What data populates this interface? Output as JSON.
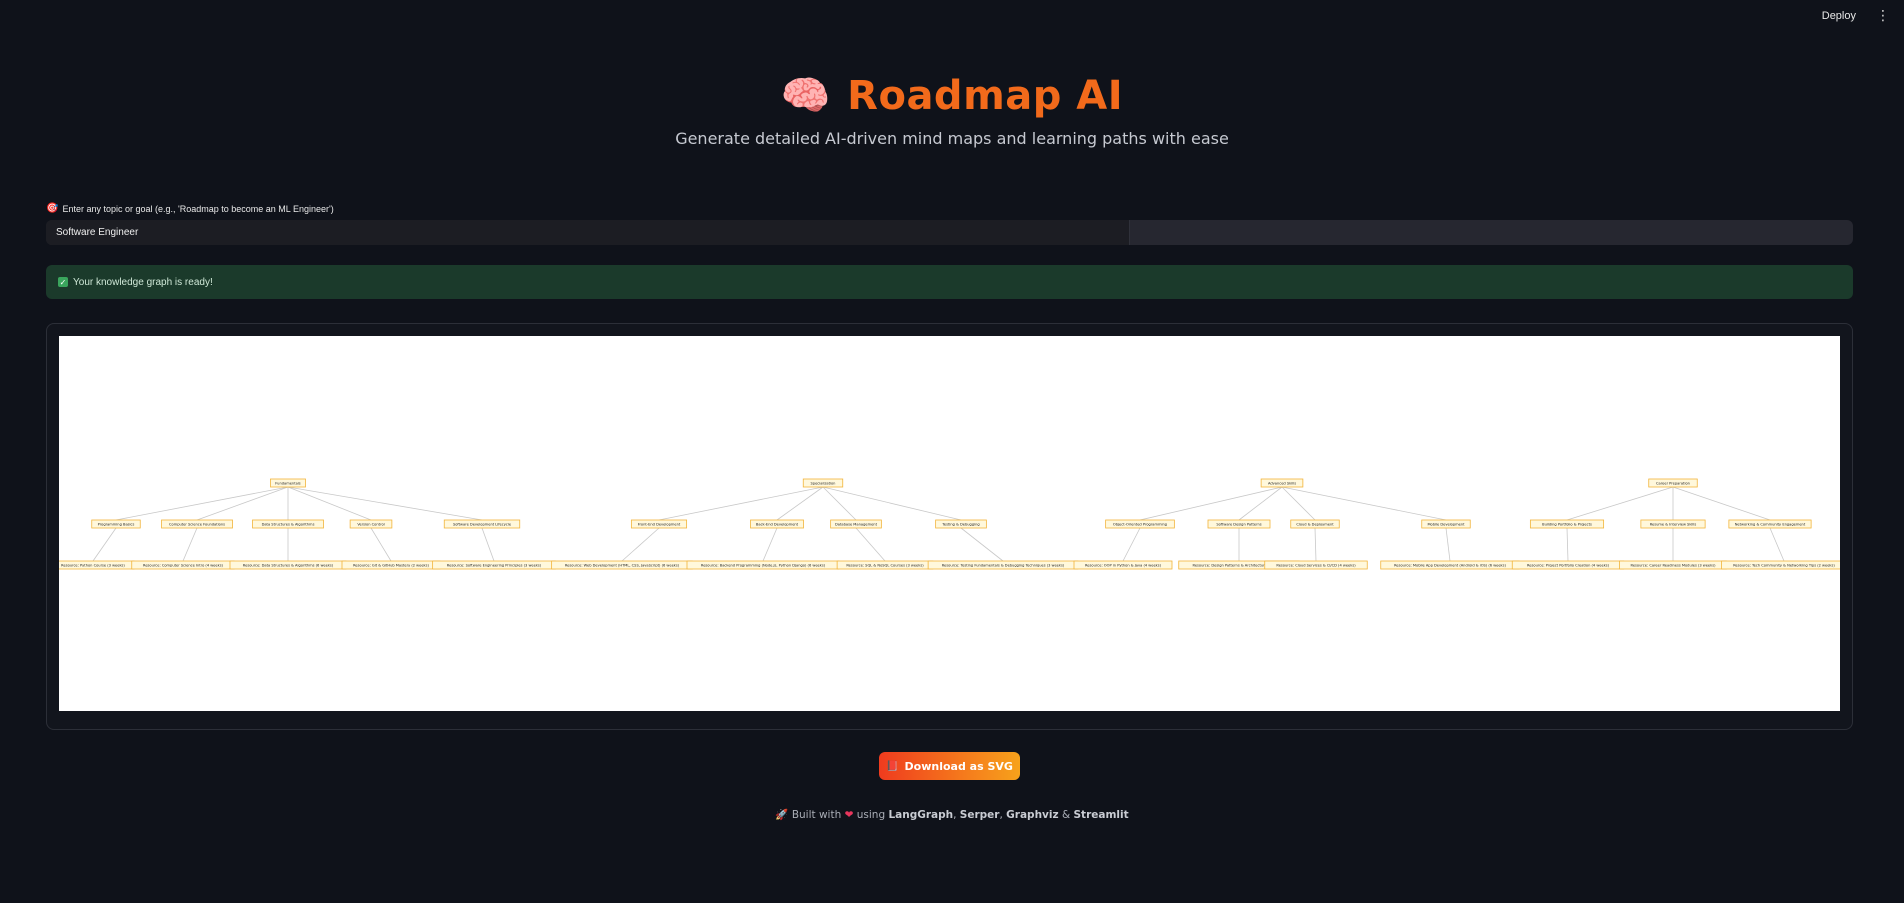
{
  "topbar": {
    "deploy_label": "Deploy",
    "menu_icon": "vertical-ellipsis-icon"
  },
  "hero": {
    "icon": "brain-icon",
    "title": "Roadmap AI",
    "subtitle": "Generate detailed AI-driven mind maps and learning paths with ease"
  },
  "input": {
    "label_icon": "target-icon",
    "label": "Enter any topic or goal (e.g., 'Roadmap to become an ML Engineer')",
    "value": "Software Engineer"
  },
  "status": {
    "icon": "check-icon",
    "message": "Your knowledge graph is ready!"
  },
  "graph": {
    "groups": [
      {
        "label": "Fundamentals",
        "children": [
          {
            "label": "Programming Basics",
            "resource": "Resource: Python Course (3 weeks)"
          },
          {
            "label": "Computer Science Foundations",
            "resource": "Resource: Computer Science Intro (4 weeks)"
          },
          {
            "label": "Data Structures & Algorithms",
            "resource": "Resource: Data Structures & Algorithms (6 weeks)"
          },
          {
            "label": "Version Control",
            "resource": "Resource: Git & GitHub Mastery (2 weeks)"
          },
          {
            "label": "Software Development Lifecycle",
            "resource": "Resource: Software Engineering Principles (3 weeks)"
          }
        ]
      },
      {
        "label": "Specialization",
        "children": [
          {
            "label": "Front-End Development",
            "resource": "Resource: Web Development (HTML, CSS, JavaScript) (6 weeks)"
          },
          {
            "label": "Back-End Development",
            "resource": "Resource: Backend Programming (Node.js, Python Django) (6 weeks)"
          },
          {
            "label": "Database Management",
            "resource": "Resource: SQL & NoSQL Courses (3 weeks)"
          },
          {
            "label": "Testing & Debugging",
            "resource": "Resource: Testing Fundamentals & Debugging Techniques (3 weeks)"
          }
        ]
      },
      {
        "label": "Advanced Skills",
        "children": [
          {
            "label": "Object-Oriented Programming",
            "resource": "Resource: OOP in Python & Java (4 weeks)"
          },
          {
            "label": "Software Design Patterns",
            "resource": "Resource: Design Patterns & Architecture (4 weeks)"
          },
          {
            "label": "Cloud & Deployment",
            "resource": "Resource: Cloud Services & CI/CD (4 weeks)"
          },
          {
            "label": "Mobile Development",
            "resource": "Resource: Mobile App Development (Android & iOS) (6 weeks)"
          }
        ]
      },
      {
        "label": "Career Preparation",
        "children": [
          {
            "label": "Building Portfolio & Projects",
            "resource": "Resource: Project Portfolio Creation (4 weeks)"
          },
          {
            "label": "Resume & Interview Skills",
            "resource": "Resource: Career Readiness Modules (3 weeks)"
          },
          {
            "label": "Networking & Community Engagement",
            "resource": "Resource: Tech Community & Networking Tips (2 weeks)"
          }
        ]
      }
    ]
  },
  "download": {
    "icon": "book-icon",
    "label": "Download as SVG"
  },
  "footer": {
    "rocket_icon": "rocket-icon",
    "prefix": "Built with",
    "heart_icon": "heart-icon",
    "using": "using",
    "tools": [
      "LangGraph",
      "Serper",
      "Graphviz",
      "Streamlit"
    ]
  }
}
